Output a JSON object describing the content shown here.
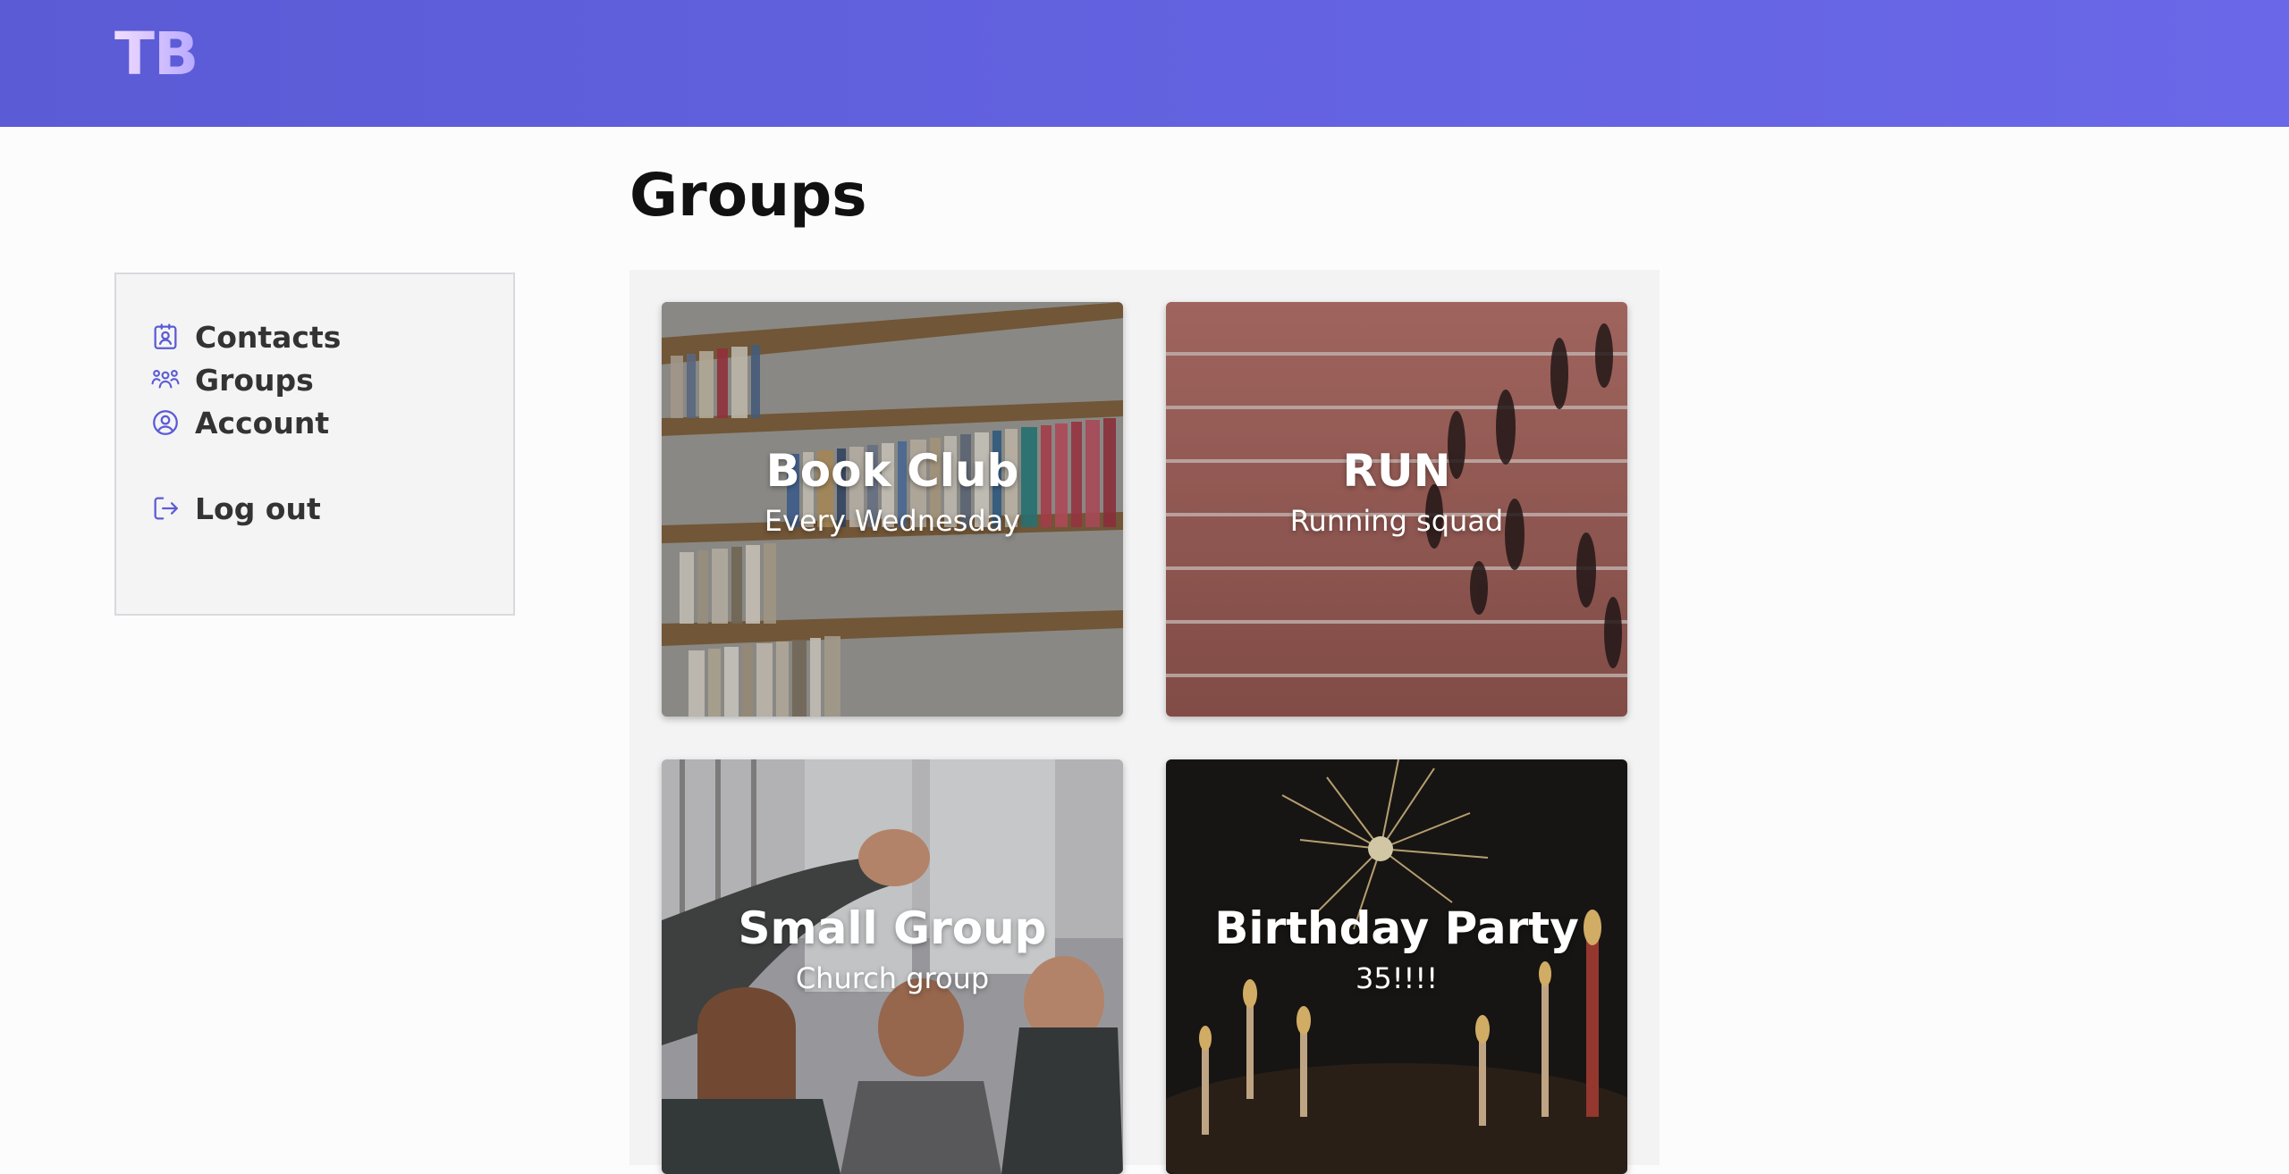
{
  "header": {
    "logo_text": "TB",
    "colors": {
      "bar_start": "#5b5bd6",
      "bar_end": "#6a68e8"
    }
  },
  "sidebar": {
    "items": [
      {
        "label": "Contacts",
        "icon": "contact-card-icon"
      },
      {
        "label": "Groups",
        "icon": "people-group-icon"
      },
      {
        "label": "Account",
        "icon": "user-circle-icon"
      },
      {
        "label": "Log out",
        "icon": "logout-icon"
      }
    ]
  },
  "main": {
    "title": "Groups",
    "groups": [
      {
        "name": "Book Club",
        "description": "Every Wednesday",
        "image": "bookshelf-photo"
      },
      {
        "name": "RUN",
        "description": "Running squad",
        "image": "running-track-photo"
      },
      {
        "name": "Small Group",
        "description": "Church group",
        "image": "friends-high-five-photo"
      },
      {
        "name": "Birthday Party",
        "description": "35!!!!",
        "image": "sparkler-candles-photo"
      }
    ]
  },
  "accent_color": "#5b5bd6"
}
